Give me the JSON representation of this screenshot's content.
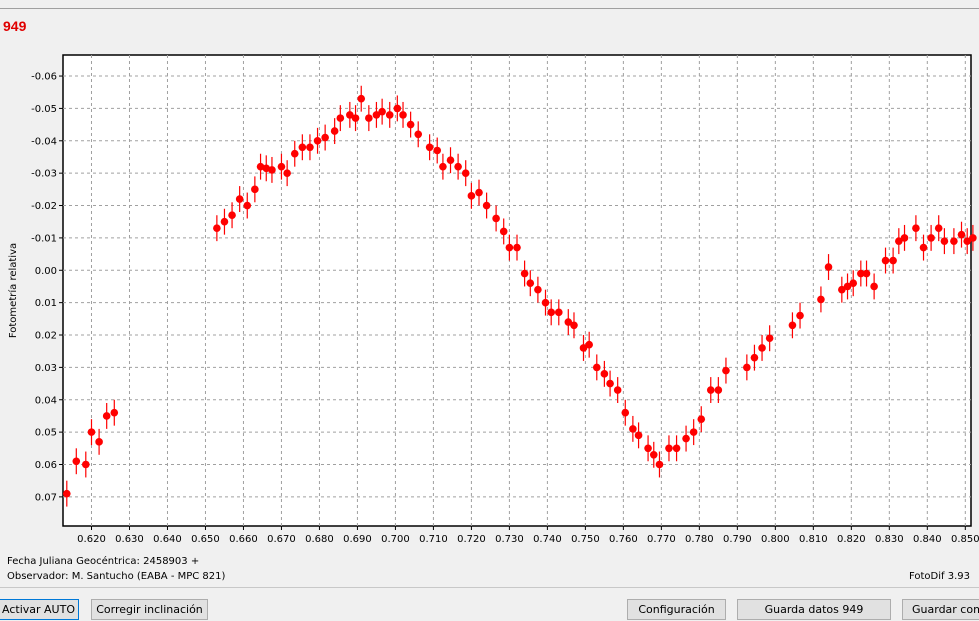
{
  "window": {
    "title": "949"
  },
  "info": {
    "date_label": "Fecha Juliana Geocéntrica: 2458903 +",
    "observer_label": "Observador: M. Santucho (EABA - MPC 821)",
    "app_version": "FotoDif 3.93"
  },
  "buttons": {
    "auto": "Activar AUTO",
    "tilt": "Corregir inclinación",
    "config": "Configuración",
    "save_data": "Guarda datos 949",
    "save_as": "Guardar como"
  },
  "chart_data": {
    "type": "scatter",
    "title": "",
    "xlabel": "",
    "ylabel": "Fotometría relativa",
    "xlim": [
      0.6125,
      0.8515
    ],
    "ylim": [
      0.079,
      -0.0665
    ],
    "y_inverted": true,
    "grid": true,
    "marker_color": "#ff0000",
    "x_ticks": [
      "0.620",
      "0.630",
      "0.640",
      "0.650",
      "0.660",
      "0.670",
      "0.680",
      "0.690",
      "0.700",
      "0.710",
      "0.720",
      "0.730",
      "0.740",
      "0.750",
      "0.760",
      "0.770",
      "0.780",
      "0.790",
      "0.800",
      "0.810",
      "0.820",
      "0.830",
      "0.840",
      "0.850"
    ],
    "y_ticks": [
      "-0.06",
      "-0.05",
      "-0.04",
      "-0.03",
      "-0.02",
      "-0.01",
      "0.00",
      "0.01",
      "0.02",
      "0.03",
      "0.04",
      "0.05",
      "0.06",
      "0.07"
    ],
    "error_bar": 0.004,
    "points": [
      [
        0.6135,
        0.069
      ],
      [
        0.616,
        0.059
      ],
      [
        0.6185,
        0.06
      ],
      [
        0.62,
        0.05
      ],
      [
        0.622,
        0.053
      ],
      [
        0.624,
        0.045
      ],
      [
        0.626,
        0.044
      ],
      [
        0.653,
        -0.013
      ],
      [
        0.655,
        -0.015
      ],
      [
        0.657,
        -0.017
      ],
      [
        0.659,
        -0.022
      ],
      [
        0.661,
        -0.02
      ],
      [
        0.663,
        -0.025
      ],
      [
        0.6645,
        -0.032
      ],
      [
        0.666,
        -0.0315
      ],
      [
        0.6675,
        -0.031
      ],
      [
        0.67,
        -0.032
      ],
      [
        0.6715,
        -0.03
      ],
      [
        0.6735,
        -0.036
      ],
      [
        0.6755,
        -0.038
      ],
      [
        0.6775,
        -0.038
      ],
      [
        0.6795,
        -0.04
      ],
      [
        0.6815,
        -0.041
      ],
      [
        0.684,
        -0.043
      ],
      [
        0.6855,
        -0.047
      ],
      [
        0.688,
        -0.048
      ],
      [
        0.6895,
        -0.047
      ],
      [
        0.691,
        -0.053
      ],
      [
        0.693,
        -0.047
      ],
      [
        0.695,
        -0.048
      ],
      [
        0.6965,
        -0.049
      ],
      [
        0.6985,
        -0.048
      ],
      [
        0.7005,
        -0.05
      ],
      [
        0.702,
        -0.048
      ],
      [
        0.704,
        -0.045
      ],
      [
        0.706,
        -0.042
      ],
      [
        0.709,
        -0.038
      ],
      [
        0.711,
        -0.037
      ],
      [
        0.7125,
        -0.032
      ],
      [
        0.7145,
        -0.034
      ],
      [
        0.7165,
        -0.032
      ],
      [
        0.7185,
        -0.03
      ],
      [
        0.72,
        -0.023
      ],
      [
        0.722,
        -0.024
      ],
      [
        0.724,
        -0.02
      ],
      [
        0.7265,
        -0.016
      ],
      [
        0.7285,
        -0.012
      ],
      [
        0.73,
        -0.007
      ],
      [
        0.732,
        -0.007
      ],
      [
        0.734,
        0.001
      ],
      [
        0.7355,
        0.004
      ],
      [
        0.7375,
        0.006
      ],
      [
        0.7395,
        0.01
      ],
      [
        0.741,
        0.013
      ],
      [
        0.743,
        0.013
      ],
      [
        0.7455,
        0.016
      ],
      [
        0.747,
        0.017
      ],
      [
        0.7495,
        0.024
      ],
      [
        0.751,
        0.023
      ],
      [
        0.753,
        0.03
      ],
      [
        0.755,
        0.032
      ],
      [
        0.7565,
        0.035
      ],
      [
        0.7585,
        0.037
      ],
      [
        0.7605,
        0.044
      ],
      [
        0.7625,
        0.049
      ],
      [
        0.764,
        0.051
      ],
      [
        0.7665,
        0.055
      ],
      [
        0.768,
        0.057
      ],
      [
        0.7695,
        0.06
      ],
      [
        0.772,
        0.055
      ],
      [
        0.774,
        0.055
      ],
      [
        0.7765,
        0.052
      ],
      [
        0.7785,
        0.05
      ],
      [
        0.7805,
        0.046
      ],
      [
        0.783,
        0.037
      ],
      [
        0.785,
        0.037
      ],
      [
        0.787,
        0.031
      ],
      [
        0.7925,
        0.03
      ],
      [
        0.7945,
        0.027
      ],
      [
        0.7965,
        0.024
      ],
      [
        0.7985,
        0.021
      ],
      [
        0.8045,
        0.017
      ],
      [
        0.8065,
        0.014
      ],
      [
        0.812,
        0.009
      ],
      [
        0.814,
        -0.001
      ],
      [
        0.8175,
        0.006
      ],
      [
        0.819,
        0.005
      ],
      [
        0.8205,
        0.004
      ],
      [
        0.8225,
        0.001
      ],
      [
        0.824,
        0.001
      ],
      [
        0.826,
        0.005
      ],
      [
        0.829,
        -0.003
      ],
      [
        0.831,
        -0.003
      ],
      [
        0.8325,
        -0.009
      ],
      [
        0.834,
        -0.01
      ],
      [
        0.837,
        -0.013
      ],
      [
        0.839,
        -0.007
      ],
      [
        0.841,
        -0.01
      ],
      [
        0.843,
        -0.013
      ],
      [
        0.8445,
        -0.009
      ],
      [
        0.847,
        -0.009
      ],
      [
        0.849,
        -0.011
      ],
      [
        0.8505,
        -0.009
      ],
      [
        0.852,
        -0.01
      ]
    ]
  }
}
